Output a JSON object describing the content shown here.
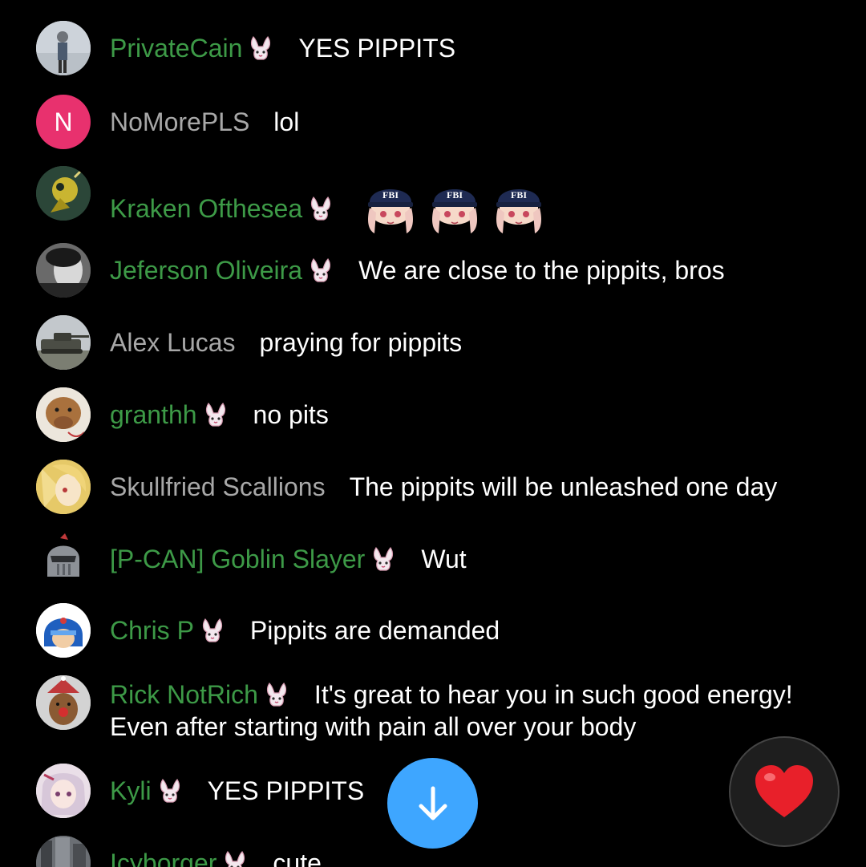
{
  "colors": {
    "background": "#000000",
    "member_name": "#3d9a47",
    "guest_name": "#a8a8a8",
    "message": "#ffffff",
    "scroll_button": "#3ea6ff",
    "heart": "#e8202a"
  },
  "messages": [
    {
      "author": "PrivateCain",
      "member": true,
      "badge": "bunny-badge-icon",
      "text": "YES PIPPITS",
      "avatar": "photo"
    },
    {
      "author": "NoMorePLS",
      "member": false,
      "text": "lol",
      "avatar_letter": "N",
      "avatar_color": "#e8316e"
    },
    {
      "author": "Kraken Ofthesea",
      "member": true,
      "badge": "bunny-badge-icon",
      "text": "",
      "emotes": [
        "fbi-emote",
        "fbi-emote",
        "fbi-emote"
      ],
      "avatar": "photo"
    },
    {
      "author": "Jeferson Oliveira",
      "member": true,
      "badge": "bunny-badge-icon",
      "text": "We are close to the pippits, bros",
      "avatar": "photo"
    },
    {
      "author": "Alex Lucas",
      "member": false,
      "text": "praying for pippits",
      "avatar": "photo"
    },
    {
      "author": "granthh",
      "member": true,
      "badge": "bunny-badge-icon",
      "text": "no pits",
      "avatar": "photo"
    },
    {
      "author": "Skullfried Scallions",
      "member": false,
      "text": "The pippits will be unleashed one day",
      "avatar": "photo"
    },
    {
      "author": "[P-CAN] Goblin Slayer",
      "member": true,
      "badge": "bunny-badge-icon",
      "text": "Wut",
      "avatar": "photo"
    },
    {
      "author": "Chris P",
      "member": true,
      "badge": "bunny-badge-icon",
      "text": "Pippits are demanded",
      "avatar": "photo"
    },
    {
      "author": "Rick NotRich",
      "member": true,
      "badge": "bunny-badge-icon",
      "text": "It's great to hear you in such good energy! Even after starting with pain all over your body",
      "avatar": "photo"
    },
    {
      "author": "Kyli",
      "member": true,
      "badge": "bunny-badge-icon",
      "text": "YES PIPPITS",
      "avatar": "photo"
    },
    {
      "author": "Icyborger",
      "member": true,
      "badge": "bunny-badge-icon",
      "text": "cute",
      "avatar": "photo"
    }
  ],
  "controls": {
    "scroll_down": "arrow-down-icon",
    "heart": "heart-icon"
  }
}
